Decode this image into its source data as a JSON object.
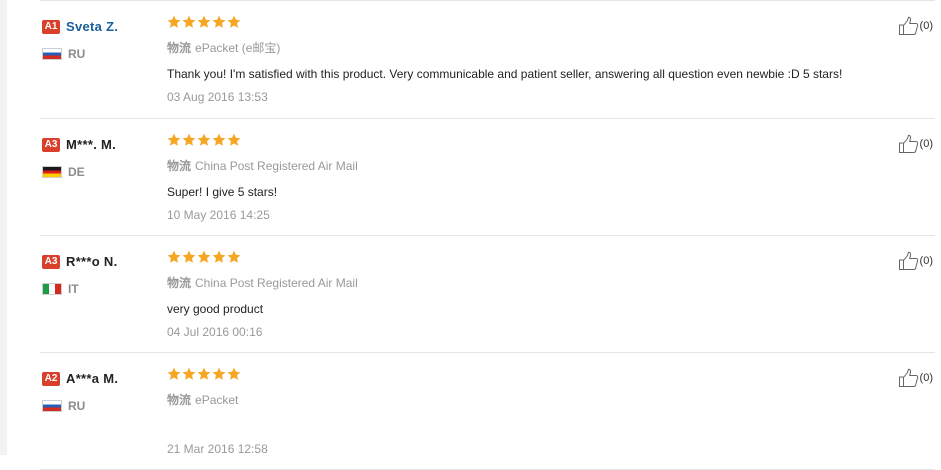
{
  "reviews": [
    {
      "level": "A1",
      "name": "Sveta Z.",
      "name_is_link": true,
      "country": "RU",
      "rating": 5,
      "logistics_label": "物流",
      "logistics": "ePacket (e邮宝)",
      "comment": "Thank you! I'm satisfied with this product. Very communicable and patient seller, answering all question even newbie :D 5 stars!",
      "date": "03 Aug 2016 13:53",
      "helpful_count": "(0)"
    },
    {
      "level": "A3",
      "name": "M***. M.",
      "name_is_link": false,
      "country": "DE",
      "rating": 5,
      "logistics_label": "物流",
      "logistics": "China Post Registered Air Mail",
      "comment": "Super! I give 5 stars!",
      "date": "10 May 2016 14:25",
      "helpful_count": "(0)"
    },
    {
      "level": "A3",
      "name": "R***o N.",
      "name_is_link": false,
      "country": "IT",
      "rating": 5,
      "logistics_label": "物流",
      "logistics": "China Post Registered Air Mail",
      "comment": "very good product",
      "date": "04 Jul 2016 00:16",
      "helpful_count": "(0)"
    },
    {
      "level": "A2",
      "name": "A***a M.",
      "name_is_link": false,
      "country": "RU",
      "rating": 5,
      "logistics_label": "物流",
      "logistics": "ePacket",
      "comment": "",
      "date": "21 Mar 2016 12:58",
      "helpful_count": "(0)"
    }
  ],
  "colors": {
    "star": "#f5a623",
    "badge": "#d9402b",
    "link": "#1a5e9c",
    "muted": "#999999"
  }
}
